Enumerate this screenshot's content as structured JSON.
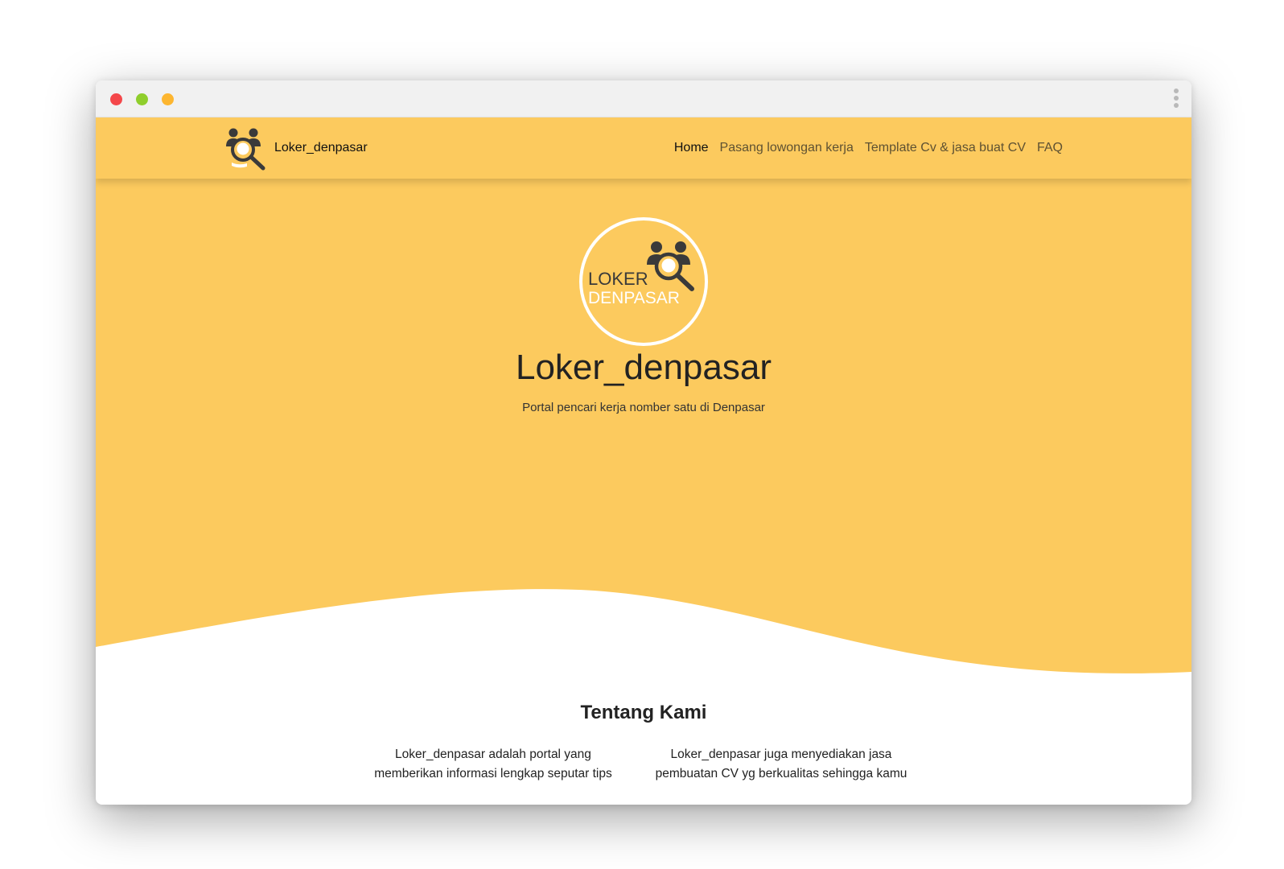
{
  "navbar": {
    "brand": "Loker_denpasar",
    "links": [
      "Home",
      "Pasang lowongan kerja",
      "Template Cv & jasa buat CV",
      "FAQ"
    ],
    "active": "Home"
  },
  "hero": {
    "logo_text_line1": "LOKER",
    "logo_text_line2": "DENPASAR",
    "title": "Loker_denpasar",
    "subtitle": "Portal pencari kerja nomber satu di Denpasar"
  },
  "about": {
    "title": "Tentang Kami",
    "col1": "Loker_denpasar adalah portal yang memberikan informasi lengkap seputar tips",
    "col2": "Loker_denpasar juga menyediakan jasa pembuatan CV yg berkualitas sehingga kamu"
  },
  "colors": {
    "brand_yellow": "#fcca5e",
    "icon_dark": "#3a3a3a",
    "traffic_red": "#f4474a",
    "traffic_green": "#8fce2c",
    "traffic_yellow": "#fdb630"
  },
  "icons": [
    "people-search-icon",
    "kebab-menu-icon"
  ]
}
